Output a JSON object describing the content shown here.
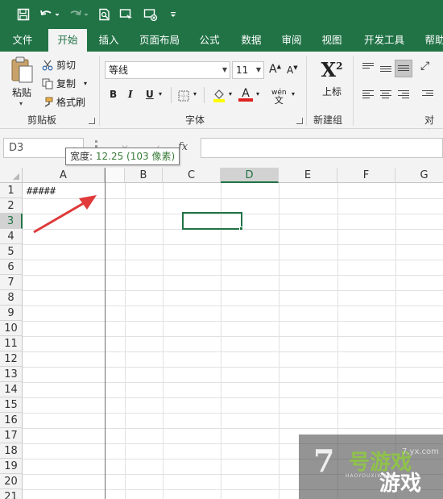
{
  "ribbon_tabs": [
    "文件",
    "开始",
    "插入",
    "页面布局",
    "公式",
    "数据",
    "审阅",
    "视图",
    "开发工具",
    "帮助"
  ],
  "active_tab": "开始",
  "clipboard": {
    "paste": "粘贴",
    "cut": "剪切",
    "copy": "复制",
    "format_painter": "格式刷",
    "group_label": "剪贴板"
  },
  "font": {
    "name": "等线",
    "size": "11",
    "bold": "B",
    "italic": "I",
    "underline": "U",
    "grow": "A",
    "shrink": "A",
    "font_color": "A",
    "phonetic": "wén",
    "group_label": "字体"
  },
  "superscript": {
    "label": "上标",
    "group_label": "新建组"
  },
  "alignment": {
    "group_label": "对齐"
  },
  "name_box": "D3",
  "fx_label": "fx",
  "tooltip": {
    "prefix": "宽度: ",
    "value": "12.25",
    "detail": "(103 像素)"
  },
  "columns": [
    "A",
    "B",
    "C",
    "D",
    "E",
    "F",
    "G"
  ],
  "rows": [
    "1",
    "2",
    "3",
    "4",
    "5",
    "6",
    "7",
    "8",
    "9",
    "10",
    "11",
    "12",
    "13",
    "14",
    "15",
    "16",
    "17",
    "18",
    "19",
    "20",
    "21"
  ],
  "selected_column": "D",
  "selected_row": "3",
  "cells": {
    "A1": "#####"
  },
  "watermark": {
    "big": "7",
    "cn1": "号游戏",
    "cn2": "游戏",
    "url": "7.yx.com",
    "sub": "HAOYOUXIWANG"
  },
  "colors": {
    "excel_green": "#217346",
    "arrow_red": "#e03a3a"
  }
}
